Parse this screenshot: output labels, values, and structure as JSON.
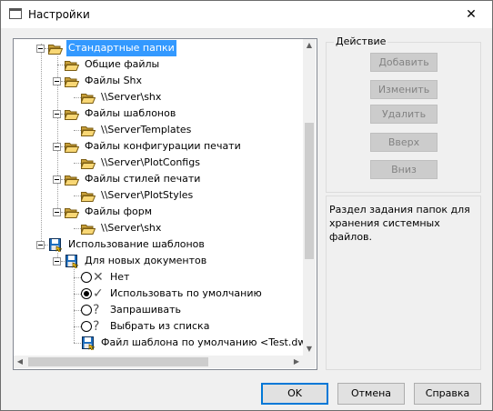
{
  "window": {
    "title": "Настройки",
    "close_glyph": "✕"
  },
  "tree": {
    "items": [
      {
        "label": "Стандартные папки",
        "icon": "folder-open-icon",
        "selected": true
      },
      {
        "label": "Общие файлы",
        "icon": "folder-open-icon"
      },
      {
        "label": "Файлы Shx",
        "icon": "folder-open-icon"
      },
      {
        "label": "\\\\Server\\shx",
        "icon": "folder-open-icon"
      },
      {
        "label": "Файлы шаблонов",
        "icon": "folder-open-icon"
      },
      {
        "label": "\\\\ServerTemplates",
        "icon": "folder-open-icon"
      },
      {
        "label": "Файлы конфигурации печати",
        "icon": "folder-open-icon"
      },
      {
        "label": "\\\\Server\\PlotConfigs",
        "icon": "folder-open-icon"
      },
      {
        "label": "Файлы стилей печати",
        "icon": "folder-open-icon"
      },
      {
        "label": "\\\\Server\\PlotStyles",
        "icon": "folder-open-icon"
      },
      {
        "label": "Файлы форм",
        "icon": "folder-open-icon"
      },
      {
        "label": "\\\\Server\\shx",
        "icon": "folder-open-icon"
      },
      {
        "label": "Использование шаблонов",
        "icon": "floppy-disk-icon"
      },
      {
        "label": "Для новых документов",
        "icon": "floppy-disk-icon"
      },
      {
        "label": "Нет",
        "icon": "cross-icon",
        "radio": false
      },
      {
        "label": "Использовать по умолчанию",
        "icon": "checkmark-icon",
        "radio": true
      },
      {
        "label": "Запрашивать",
        "icon": "question-icon",
        "radio": false
      },
      {
        "label": "Выбрать из списка",
        "icon": "question-icon",
        "radio": false
      },
      {
        "label": "Файл шаблона по умолчанию <Test.dwt>",
        "icon": "floppy-disk-icon"
      }
    ]
  },
  "scroll": {
    "up": "▲",
    "down": "▼",
    "left": "◀",
    "right": "▶"
  },
  "actions": {
    "title": "Действие",
    "add": "Добавить",
    "edit": "Изменить",
    "delete": "Удалить",
    "up": "Вверх",
    "down": "Вниз"
  },
  "description": "Раздел задания папок для хранения системных файлов.",
  "footer": {
    "ok": "OK",
    "cancel": "Отмена",
    "help": "Справка"
  },
  "colors": {
    "selection": "#3399ff",
    "folder": "#f8d775",
    "disk": "#1e6fbf"
  }
}
